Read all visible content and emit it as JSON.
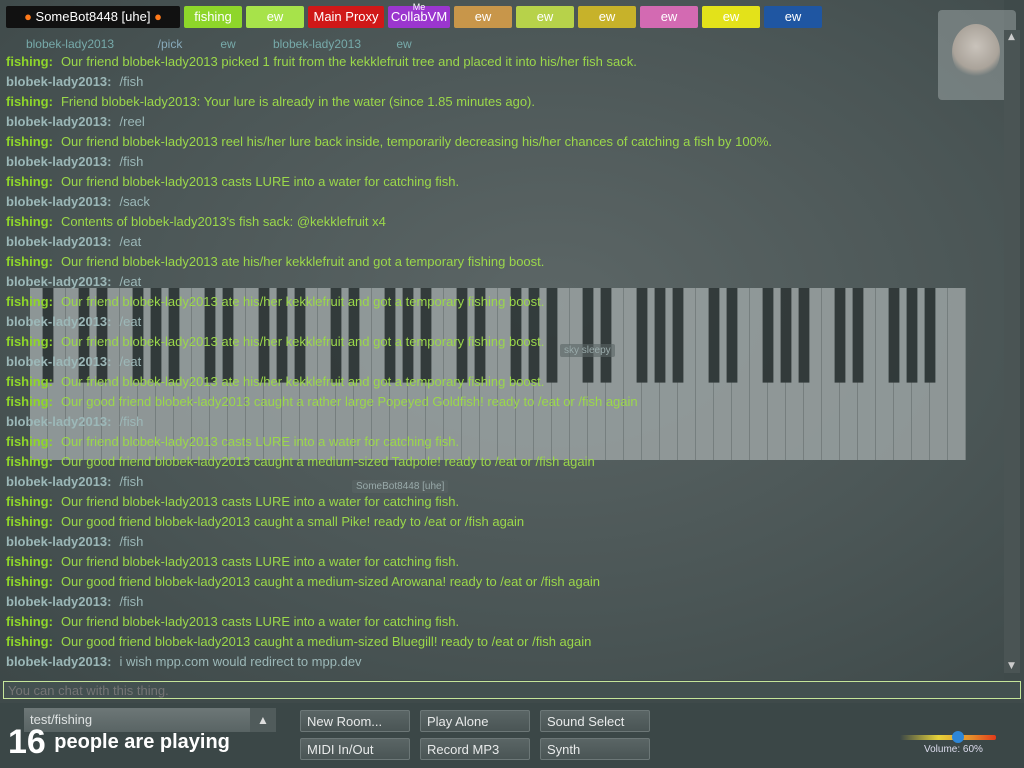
{
  "user_bar": [
    {
      "label": "SomeBot8448 [uhe]",
      "bg": "#111111",
      "icon": "pumpkin-icon",
      "me": ""
    },
    {
      "label": "fishing",
      "bg": "#8ed62a",
      "me": ""
    },
    {
      "label": "ew",
      "bg": "#a7e34a",
      "me": ""
    },
    {
      "label": "Main Proxy",
      "bg": "#d01818",
      "me": ""
    },
    {
      "label": "CollabVM",
      "bg": "#9b36cf",
      "me": "Me"
    },
    {
      "label": "ew",
      "bg": "#c8964a",
      "me": ""
    },
    {
      "label": "ew",
      "bg": "#b7d24a",
      "me": ""
    },
    {
      "label": "ew",
      "bg": "#c7b22a",
      "me": ""
    },
    {
      "label": "ew",
      "bg": "#d36ab2",
      "me": ""
    },
    {
      "label": "ew",
      "bg": "#e3e21a",
      "me": ""
    },
    {
      "label": "ew",
      "bg": "#1f56a2",
      "me": ""
    }
  ],
  "top_chips": [
    {
      "label": "blobek-lady2013",
      "color": "#7aa"
    },
    {
      "label": "/pick",
      "color": "#8ab"
    },
    {
      "label": "ew",
      "color": "#7aa"
    },
    {
      "label": "blobek-lady2013",
      "color": "#7aa"
    },
    {
      "label": "ew",
      "color": "#7aa"
    }
  ],
  "chat": [
    {
      "nick": "fishing:",
      "type": "fish",
      "text": "Our friend blobek-lady2013 picked 1 fruit from the kekklefruit tree and placed it into his/her fish sack."
    },
    {
      "nick": "blobek-lady2013:",
      "type": "user",
      "text": "/fish"
    },
    {
      "nick": "fishing:",
      "type": "fish",
      "text": "Friend blobek-lady2013: Your lure is already in the water (since 1.85 minutes ago)."
    },
    {
      "nick": "blobek-lady2013:",
      "type": "user",
      "text": "/reel"
    },
    {
      "nick": "fishing:",
      "type": "fish",
      "text": "Our friend blobek-lady2013 reel his/her lure back inside, temporarily decreasing his/her chances of catching a fish by 100%."
    },
    {
      "nick": "blobek-lady2013:",
      "type": "user",
      "text": "/fish"
    },
    {
      "nick": "fishing:",
      "type": "fish",
      "text": "Our friend blobek-lady2013 casts LURE into a water for catching fish."
    },
    {
      "nick": "blobek-lady2013:",
      "type": "user",
      "text": "/sack"
    },
    {
      "nick": "fishing:",
      "type": "fish",
      "text": "Contents of blobek-lady2013's fish sack: @kekklefruit x4"
    },
    {
      "nick": "blobek-lady2013:",
      "type": "user",
      "text": "/eat"
    },
    {
      "nick": "fishing:",
      "type": "fish",
      "text": "Our friend blobek-lady2013 ate his/her kekklefruit and got a temporary fishing boost."
    },
    {
      "nick": "blobek-lady2013:",
      "type": "user",
      "text": "/eat"
    },
    {
      "nick": "fishing:",
      "type": "fish",
      "text": "Our friend blobek-lady2013 ate his/her kekklefruit and got a temporary fishing boost."
    },
    {
      "nick": "blobek-lady2013:",
      "type": "user",
      "text": "/eat"
    },
    {
      "nick": "fishing:",
      "type": "fish",
      "text": "Our friend blobek-lady2013 ate his/her kekklefruit and got a temporary fishing boost."
    },
    {
      "nick": "blobek-lady2013:",
      "type": "user",
      "text": "/eat"
    },
    {
      "nick": "fishing:",
      "type": "fish",
      "text": "Our friend blobek-lady2013 ate his/her kekklefruit and got a temporary fishing boost."
    },
    {
      "nick": "fishing:",
      "type": "fish",
      "text": "Our good friend blobek-lady2013 caught a rather large Popeyed Goldfish! ready to /eat or /fish again"
    },
    {
      "nick": "blobek-lady2013:",
      "type": "user",
      "text": "/fish"
    },
    {
      "nick": "fishing:",
      "type": "fish",
      "text": "Our friend blobek-lady2013 casts LURE into a water for catching fish."
    },
    {
      "nick": "fishing:",
      "type": "fish",
      "text": "Our good friend blobek-lady2013 caught a medium-sized Tadpole! ready to /eat or /fish again"
    },
    {
      "nick": "blobek-lady2013:",
      "type": "user",
      "text": "/fish"
    },
    {
      "nick": "fishing:",
      "type": "fish",
      "text": "Our friend blobek-lady2013 casts LURE into a water for catching fish."
    },
    {
      "nick": "fishing:",
      "type": "fish",
      "text": "Our good friend blobek-lady2013 caught a small Pike! ready to /eat or /fish again"
    },
    {
      "nick": "blobek-lady2013:",
      "type": "user",
      "text": "/fish"
    },
    {
      "nick": "fishing:",
      "type": "fish",
      "text": "Our friend blobek-lady2013 casts LURE into a water for catching fish."
    },
    {
      "nick": "fishing:",
      "type": "fish",
      "text": "Our good friend blobek-lady2013 caught a medium-sized Arowana! ready to /eat or /fish again"
    },
    {
      "nick": "blobek-lady2013:",
      "type": "user",
      "text": "/fish"
    },
    {
      "nick": "fishing:",
      "type": "fish",
      "text": "Our friend blobek-lady2013 casts LURE into a water for catching fish."
    },
    {
      "nick": "fishing:",
      "type": "fish",
      "text": "Our good friend blobek-lady2013 caught a medium-sized Bluegill! ready to /eat or /fish again"
    },
    {
      "nick": "blobek-lady2013:",
      "type": "user",
      "text": "i wish mpp.com would redirect to mpp.dev"
    }
  ],
  "cursor_labels": {
    "piano_cursor": "SomeBot8448 [uhe]",
    "other_cursor": "sky sleepy"
  },
  "chat_input": {
    "placeholder": "You can chat with this thing."
  },
  "room": {
    "name": "test/fishing"
  },
  "buttons": {
    "new_room": "New Room...",
    "play_alone": "Play Alone",
    "sound_select": "Sound Select",
    "midi": "MIDI In/Out",
    "record": "Record MP3",
    "synth": "Synth"
  },
  "player_count": {
    "number": "16",
    "text": "people are playing"
  },
  "volume": {
    "label": "Volume: 60%",
    "level": 0.6
  }
}
